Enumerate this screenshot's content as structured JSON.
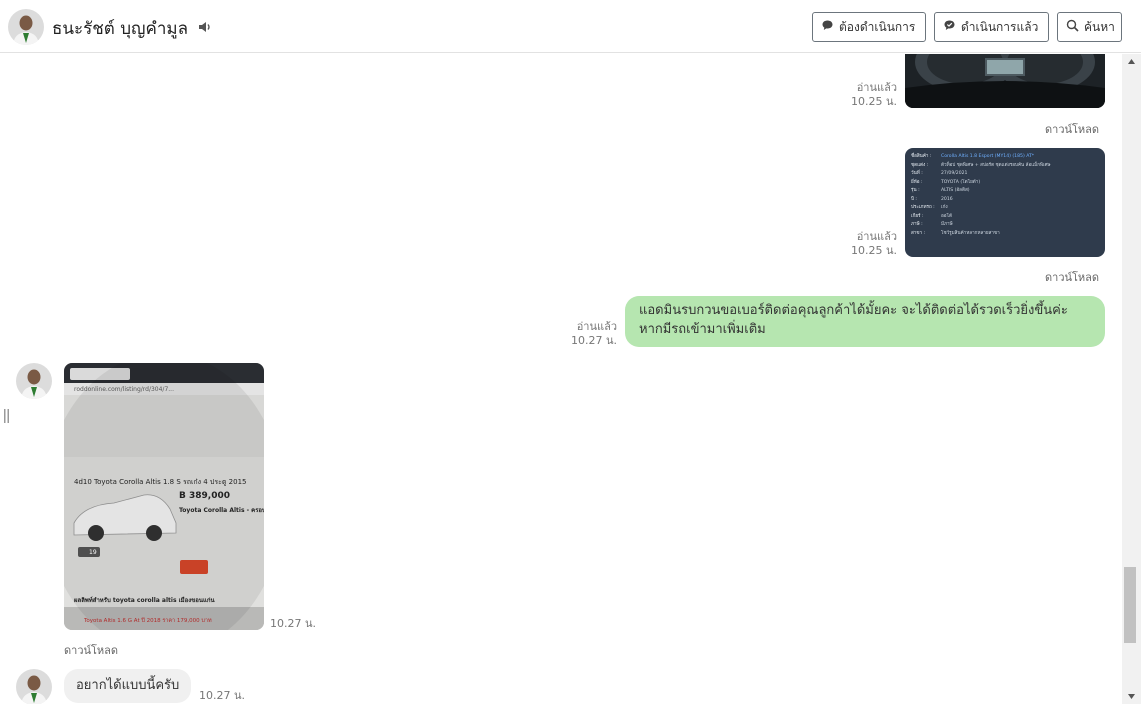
{
  "header": {
    "contact_name": "ธนะรัชต์ บุญคำมูล",
    "buttons": {
      "pending": "ต้องดำเนินการ",
      "done": "ดำเนินการแล้ว",
      "search": "ค้นหา"
    }
  },
  "messages": {
    "m1": {
      "read": "อ่านแล้ว",
      "time": "10.25 น.",
      "download": "ดาวน์โหลด"
    },
    "m2": {
      "read": "อ่านแล้ว",
      "time": "10.25 น.",
      "download": "ดาวน์โหลด",
      "doc_rows": [
        {
          "k": "ชื่อสินค้า :",
          "v": "Corolla Altis 1.8 Esport (MY14) (185) AT*"
        },
        {
          "k": "ชุดแต่ง :",
          "v": "ตัวท็อป ชุดพิเศษ + สปอร์ต ชุดแต่งรอบคัน ล้อแม็กพิเศษ"
        },
        {
          "k": "วันที่ :",
          "v": "27/09/2021"
        },
        {
          "k": "ยี่ห้อ :",
          "v": "TOYOTA (โตโยต้า)"
        },
        {
          "k": "รุ่น :",
          "v": "ALTIS (อัลติส)"
        },
        {
          "k": "ปี :",
          "v": "2016"
        },
        {
          "k": "ประเภทรถ :",
          "v": "เก๋ง"
        },
        {
          "k": "เกียร์ :",
          "v": "ออโต้"
        },
        {
          "k": "ภาษี :",
          "v": "มีภาษี"
        },
        {
          "k": "สาขา :",
          "v": "โชว์รูมสินค้าหลากหลายสาขา"
        }
      ]
    },
    "m3": {
      "read": "อ่านแล้ว",
      "time": "10.27 น.",
      "text": "แอดมินรบกวนขอเบอร์ติดต่อคุณลูกค้าได้มั้ยคะ จะได้ติดต่อได้รวดเร็วยิ่งขึ้นค่ะ หากมีรถเข้ามาเพิ่มเติม"
    },
    "m4": {
      "time": "10.27 น.",
      "download": "ดาวน์โหลด",
      "screenshot": {
        "url": "roddonline.com/listing/rd/304/7...",
        "listing_title": "4d10 Toyota Corolla Altis 1.8 S รถเก๋ง 4 ประตู 2015",
        "price": "B 389,000",
        "model": "Toyota Corolla Altis - ครอบครัว",
        "photo_count": "19",
        "footer": "ผลลิพท์สำหรับ toyota corolla altis เมืองขอนแก่น",
        "footer2": "Toyota Altis 1.6 G At ปี 2018 ราคา 179,000 บาท"
      }
    },
    "m5": {
      "text": "อยากได้แบบนี้ครับ",
      "time": "10.27 น."
    }
  },
  "colors": {
    "my_bubble": "#b6e6b0",
    "their_bubble": "#f0f0f0",
    "doc_bg": "#2f3b4c"
  },
  "icons": {
    "speaker": "speaker-icon",
    "pending": "chat-bubble-icon",
    "done": "chat-check-icon",
    "search": "search-icon"
  }
}
